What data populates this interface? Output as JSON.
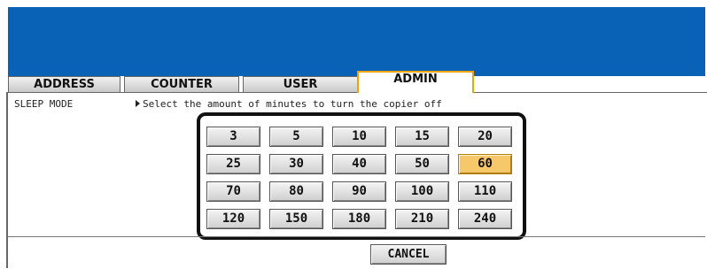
{
  "tabs": [
    {
      "label": "ADDRESS",
      "active": false
    },
    {
      "label": "COUNTER",
      "active": false
    },
    {
      "label": "USER",
      "active": false
    },
    {
      "label": "ADMIN",
      "active": true
    }
  ],
  "page": {
    "title": "SLEEP MODE",
    "instruction": "Select the amount of minutes to turn the copier off"
  },
  "minutes": {
    "options": [
      "3",
      "5",
      "10",
      "15",
      "20",
      "25",
      "30",
      "40",
      "50",
      "60",
      "70",
      "80",
      "90",
      "100",
      "110",
      "120",
      "150",
      "180",
      "210",
      "240"
    ],
    "selected": "60"
  },
  "cancel_label": "CANCEL",
  "colors": {
    "header_blue": "#0a62b6",
    "active_tab_border": "#f0a400",
    "selected_button": "#f7c86a"
  },
  "icons": {
    "instruction": "right-triangle-icon"
  }
}
